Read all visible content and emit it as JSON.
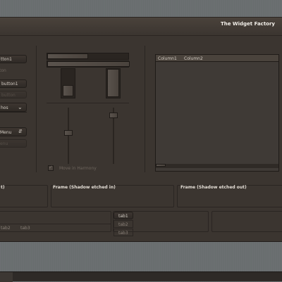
{
  "window": {
    "title": "The Widget Factory"
  },
  "left_column": {
    "button1_label": "tton1",
    "disabled1_label": "ton",
    "togglebutton_label": "button1",
    "disabled2_label": "button",
    "combo_label": "hos",
    "menu_label": "Menu",
    "disabled_menu_label": "enu"
  },
  "middle_column": {
    "checkbox_label": "Move in Harmony"
  },
  "treeview": {
    "columns": [
      "Column1",
      "Column2"
    ]
  },
  "frames": {
    "frame_left_label": "t)",
    "frame_mid_label": "Frame (Shadow etched in)",
    "frame_right_label": "Frame (Shadow etched out)"
  },
  "notebook_bottom": {
    "tabs": [
      "tab2",
      "tab3"
    ]
  },
  "notebook_left": {
    "tabs": [
      "tab1",
      "tab2",
      "tab3"
    ]
  },
  "colors": {
    "window_bg": "#3b3530",
    "desktop": "#6a6f70",
    "text": "#d6cfc6"
  }
}
